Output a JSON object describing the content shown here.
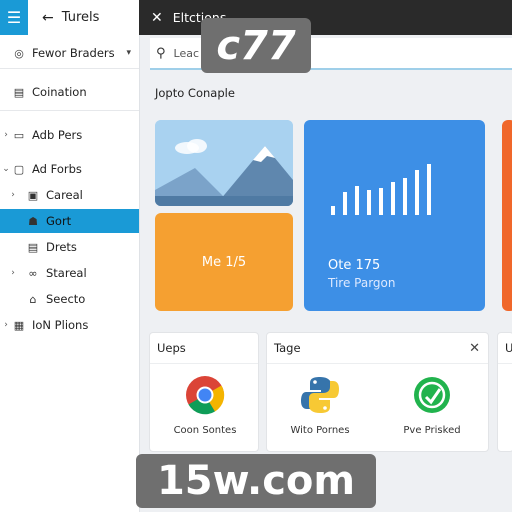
{
  "sidebar": {
    "title": "Turels",
    "items": [
      {
        "label": "Fewor Braders"
      },
      {
        "label": "Coination"
      },
      {
        "label": "Adb Pers"
      },
      {
        "label": "Ad Forbs"
      },
      {
        "label": "Careal"
      },
      {
        "label": "Gort"
      },
      {
        "label": "Drets"
      },
      {
        "label": "Stareal"
      },
      {
        "label": "Seecto"
      },
      {
        "label": "IoN Plions"
      }
    ]
  },
  "topbar": {
    "title": "Eltctions"
  },
  "search": {
    "value": "Leac"
  },
  "section": {
    "label": "Jopto Conaple"
  },
  "tiles": {
    "orange_label": "Me 1/5",
    "blue_label1": "Ote 175",
    "blue_label2": "Tire Pargon"
  },
  "cards": {
    "apps_title": "Ueps",
    "tage_title": "Tage",
    "edge_title": "U",
    "app1": "Coon Sontes",
    "app2": "Wito Pornes",
    "app3": "Pve Prisked"
  },
  "watermarks": {
    "top": "c77",
    "bottom": "15w.com"
  },
  "colors": {
    "accent": "#1a9ad6",
    "blue_tile": "#3d8fe6",
    "orange_tile": "#f5a031",
    "edge_tile": "#f0672a"
  }
}
